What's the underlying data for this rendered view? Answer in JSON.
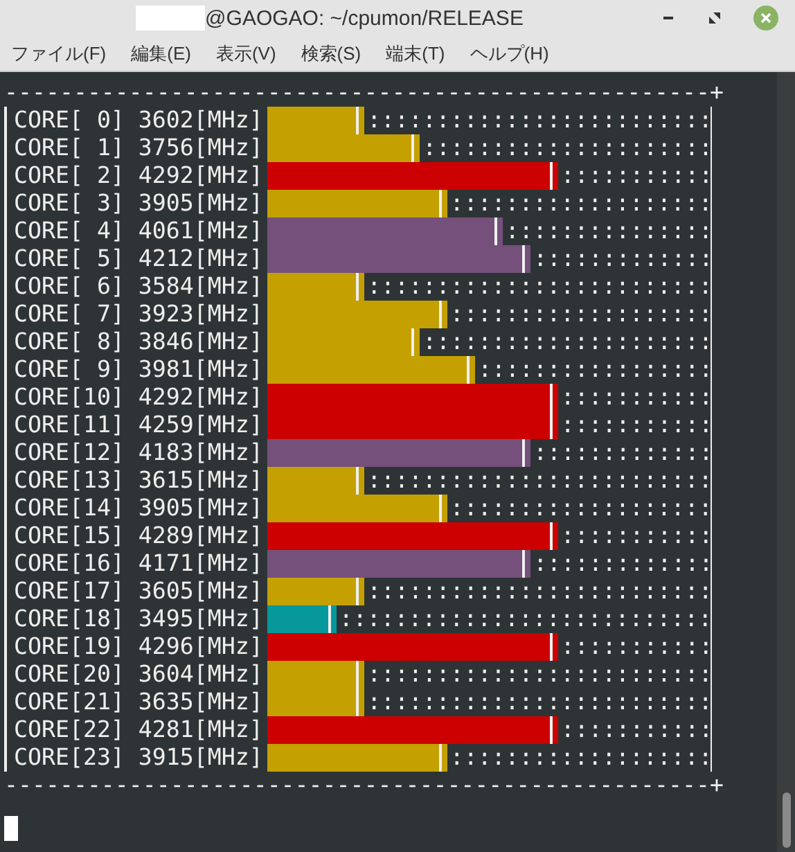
{
  "window": {
    "title": "@GAOGAO: ~/cpumon/RELEASE"
  },
  "menu": [
    "ファイル(F)",
    "編集(E)",
    "表示(V)",
    "検索(S)",
    "端末(T)",
    "ヘルプ(H)"
  ],
  "terminal": {
    "top_border": "---------------------------------------------------+",
    "rows": [
      {
        "label": "CORE[ 0] 3602[MHz]",
        "kind": "normal",
        "level": 0.219,
        "rest": ":::::::::::::::::::::::::"
      },
      {
        "label": "CORE[ 1] 3756[MHz]",
        "kind": "normal",
        "level": 0.344,
        "rest": ":::::::::::::::::::::"
      },
      {
        "label": "CORE[ 2] 4292[MHz]",
        "kind": "max",
        "level": 0.656,
        "rest": ":::::::::::"
      },
      {
        "label": "CORE[ 3] 3905[MHz]",
        "kind": "normal",
        "level": 0.406,
        "rest": ":::::::::::::::::::"
      },
      {
        "label": "CORE[ 4] 4061[MHz]",
        "kind": "high",
        "level": 0.531,
        "rest": ":::::::::::::::"
      },
      {
        "label": "CORE[ 5] 4212[MHz]",
        "kind": "high",
        "level": 0.594,
        "rest": ":::::::::::::"
      },
      {
        "label": "CORE[ 6] 3584[MHz]",
        "kind": "normal",
        "level": 0.219,
        "rest": ":::::::::::::::::::::::::"
      },
      {
        "label": "CORE[ 7] 3923[MHz]",
        "kind": "normal",
        "level": 0.406,
        "rest": ":::::::::::::::::::"
      },
      {
        "label": "CORE[ 8] 3846[MHz]",
        "kind": "normal",
        "level": 0.344,
        "rest": ":::::::::::::::::::::"
      },
      {
        "label": "CORE[ 9] 3981[MHz]",
        "kind": "normal",
        "level": 0.469,
        "rest": ":::::::::::::::::"
      },
      {
        "label": "CORE[10] 4292[MHz]",
        "kind": "max",
        "level": 0.656,
        "rest": ":::::::::::"
      },
      {
        "label": "CORE[11] 4259[MHz]",
        "kind": "max",
        "level": 0.656,
        "rest": ":::::::::::"
      },
      {
        "label": "CORE[12] 4183[MHz]",
        "kind": "high",
        "level": 0.594,
        "rest": ":::::::::::::"
      },
      {
        "label": "CORE[13] 3615[MHz]",
        "kind": "normal",
        "level": 0.219,
        "rest": ":::::::::::::::::::::::::"
      },
      {
        "label": "CORE[14] 3905[MHz]",
        "kind": "normal",
        "level": 0.406,
        "rest": ":::::::::::::::::::"
      },
      {
        "label": "CORE[15] 4289[MHz]",
        "kind": "max",
        "level": 0.656,
        "rest": ":::::::::::"
      },
      {
        "label": "CORE[16] 4171[MHz]",
        "kind": "high",
        "level": 0.594,
        "rest": ":::::::::::::"
      },
      {
        "label": "CORE[17] 3605[MHz]",
        "kind": "normal",
        "level": 0.219,
        "rest": ":::::::::::::::::::::::::"
      },
      {
        "label": "CORE[18] 3495[MHz]",
        "kind": "low",
        "level": 0.156,
        "rest": ":::::::::::::::::::::::::::"
      },
      {
        "label": "CORE[19] 4296[MHz]",
        "kind": "max",
        "level": 0.656,
        "rest": ":::::::::::"
      },
      {
        "label": "CORE[20] 3604[MHz]",
        "kind": "normal",
        "level": 0.219,
        "rest": ":::::::::::::::::::::::::"
      },
      {
        "label": "CORE[21] 3635[MHz]",
        "kind": "normal",
        "level": 0.219,
        "rest": ":::::::::::::::::::::::::"
      },
      {
        "label": "CORE[22] 4281[MHz]",
        "kind": "max",
        "level": 0.656,
        "rest": ":::::::::::"
      },
      {
        "label": "CORE[23] 3915[MHz]",
        "kind": "normal",
        "level": 0.406,
        "rest": ":::::::::::::::::::"
      }
    ],
    "bottom_border": "---------------------------------------------------+"
  }
}
